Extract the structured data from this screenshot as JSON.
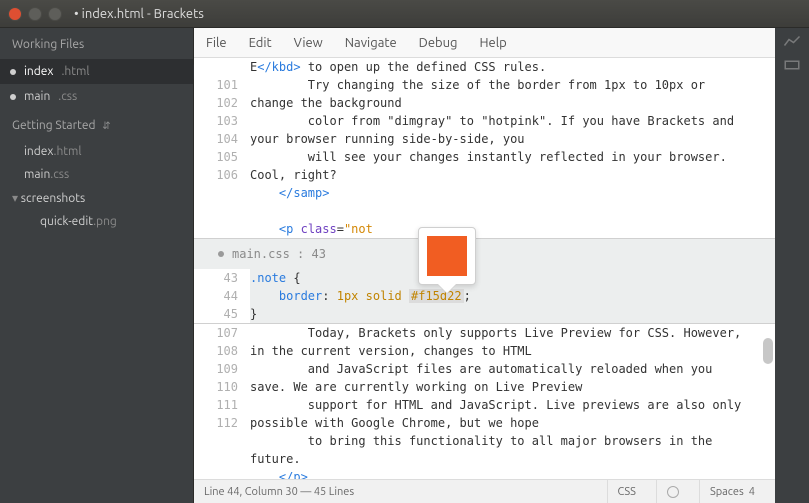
{
  "window": {
    "title": "• index.html - Brackets"
  },
  "sidebar": {
    "working_files_label": "Working Files",
    "working": [
      {
        "name": "index",
        "ext": ".html",
        "dirty": true,
        "active": true
      },
      {
        "name": "main",
        "ext": ".css",
        "dirty": true,
        "active": false
      }
    ],
    "project_label": "Getting Started",
    "tree": [
      {
        "name": "index",
        "ext": ".html",
        "type": "file"
      },
      {
        "name": "main",
        "ext": ".css",
        "type": "file"
      },
      {
        "name": "screenshots",
        "type": "folder"
      },
      {
        "name": "quick-edit",
        "ext": ".png",
        "type": "file",
        "indent": true
      }
    ]
  },
  "menu": {
    "items": [
      "File",
      "Edit",
      "View",
      "Navigate",
      "Debug",
      "Help"
    ]
  },
  "editor": {
    "upper": [
      {
        "n": "",
        "html": "E<span class='tok-tag'>&lt;/kbd&gt;</span> to open up the defined CSS rules."
      },
      {
        "n": "101",
        "html": "        Try changing the size of the border from 1px to 10px or change the background"
      },
      {
        "n": "102",
        "html": "        color from \"dimgray\" to \"hotpink\". If you have Brackets and your browser running side-by-side, you"
      },
      {
        "n": "103",
        "html": "        will see your changes instantly reflected in your browser. Cool, right?"
      },
      {
        "n": "104",
        "html": "    <span class='tok-tag'>&lt;/samp&gt;</span>"
      },
      {
        "n": "105",
        "html": ""
      },
      {
        "n": "106",
        "html": "    <span class='tok-tag'>&lt;p</span> <span class='tok-attr'>class</span>=<span class='tok-str'>\"not</span>"
      }
    ],
    "inline": {
      "header_file": "main.css",
      "header_line": "43",
      "lines": [
        {
          "n": "43",
          "html": "<span class='tok-sel'>.note</span> {"
        },
        {
          "n": "44",
          "html": "    <span class='tok-prop'>border</span>: <span class='tok-val'>1px</span> <span class='tok-val'>solid</span> <span class='tok-val tok-hex'>#f15d22</span>;"
        },
        {
          "n": "45",
          "html": "}"
        }
      ],
      "swatch_color": "#f15d22"
    },
    "lower": [
      {
        "n": "107",
        "html": "        Today, Brackets only supports Live Preview for CSS. However, in the current version, changes to HTML"
      },
      {
        "n": "108",
        "html": "        and JavaScript files are automatically reloaded when you save. We are currently working on Live Preview"
      },
      {
        "n": "109",
        "html": "        support for HTML and JavaScript. Live previews are also only possible with Google Chrome, but we hope"
      },
      {
        "n": "110",
        "html": "        to bring this functionality to all major browsers in the future."
      },
      {
        "n": "111",
        "html": "    <span class='tok-tag'>&lt;/p&gt;</span>"
      },
      {
        "n": "112",
        "html": ""
      }
    ]
  },
  "status": {
    "cursor": "Line 44, Column 30",
    "linecount": "45 Lines",
    "lang": "CSS",
    "indent_label": "Spaces",
    "indent_size": "4"
  }
}
